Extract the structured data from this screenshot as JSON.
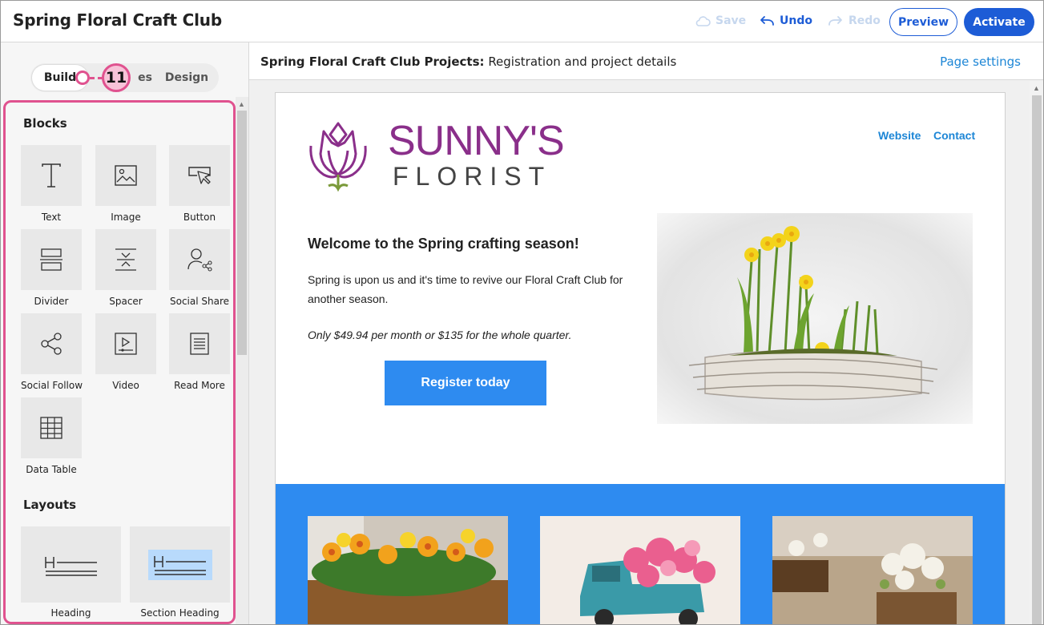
{
  "topbar": {
    "title": "Spring Floral Craft Club",
    "save_label": "Save",
    "undo_label": "Undo",
    "redo_label": "Redo",
    "preview_label": "Preview",
    "activate_label": "Activate"
  },
  "leftpanel": {
    "tabs": [
      {
        "label": "Build",
        "active": true
      },
      {
        "label": "es",
        "active": false
      },
      {
        "label": "Design",
        "active": false
      }
    ],
    "callout_number": "11",
    "blocks_heading": "Blocks",
    "blocks": [
      {
        "label": "Text",
        "icon": "text-icon"
      },
      {
        "label": "Image",
        "icon": "image-icon"
      },
      {
        "label": "Button",
        "icon": "button-cursor-icon"
      },
      {
        "label": "Divider",
        "icon": "divider-icon"
      },
      {
        "label": "Spacer",
        "icon": "spacer-icon"
      },
      {
        "label": "Social Share",
        "icon": "social-share-icon"
      },
      {
        "label": "Social Follow",
        "icon": "social-follow-icon"
      },
      {
        "label": "Video",
        "icon": "video-icon"
      },
      {
        "label": "Read More",
        "icon": "read-more-icon"
      },
      {
        "label": "Data Table",
        "icon": "data-table-icon"
      }
    ],
    "layouts_heading": "Layouts",
    "layouts": [
      {
        "label": "Heading",
        "icon": "heading-layout-icon"
      },
      {
        "label": "Section Heading",
        "icon": "section-heading-layout-icon"
      }
    ]
  },
  "main": {
    "page_name_bold": "Spring Floral Craft Club Projects:",
    "page_name_rest": "Registration and project details",
    "page_settings_label": "Page settings",
    "email": {
      "brand_line1": "SUNNY'S",
      "brand_line2": "FLORIST",
      "nav_website": "Website",
      "nav_contact": "Contact",
      "welcome": "Welcome to the Spring crafting season!",
      "intro": "Spring is upon us and it's time to revive our Floral Craft Club for another season.",
      "price": "Only $49.94 per month or $135 for the whole quarter.",
      "cta_label": "Register today"
    }
  },
  "colors": {
    "accent": "#1d5cd6",
    "link": "#1d86d6",
    "callout": "#e0528f",
    "band": "#2e8bf0",
    "brand": "#8a2f8a"
  }
}
